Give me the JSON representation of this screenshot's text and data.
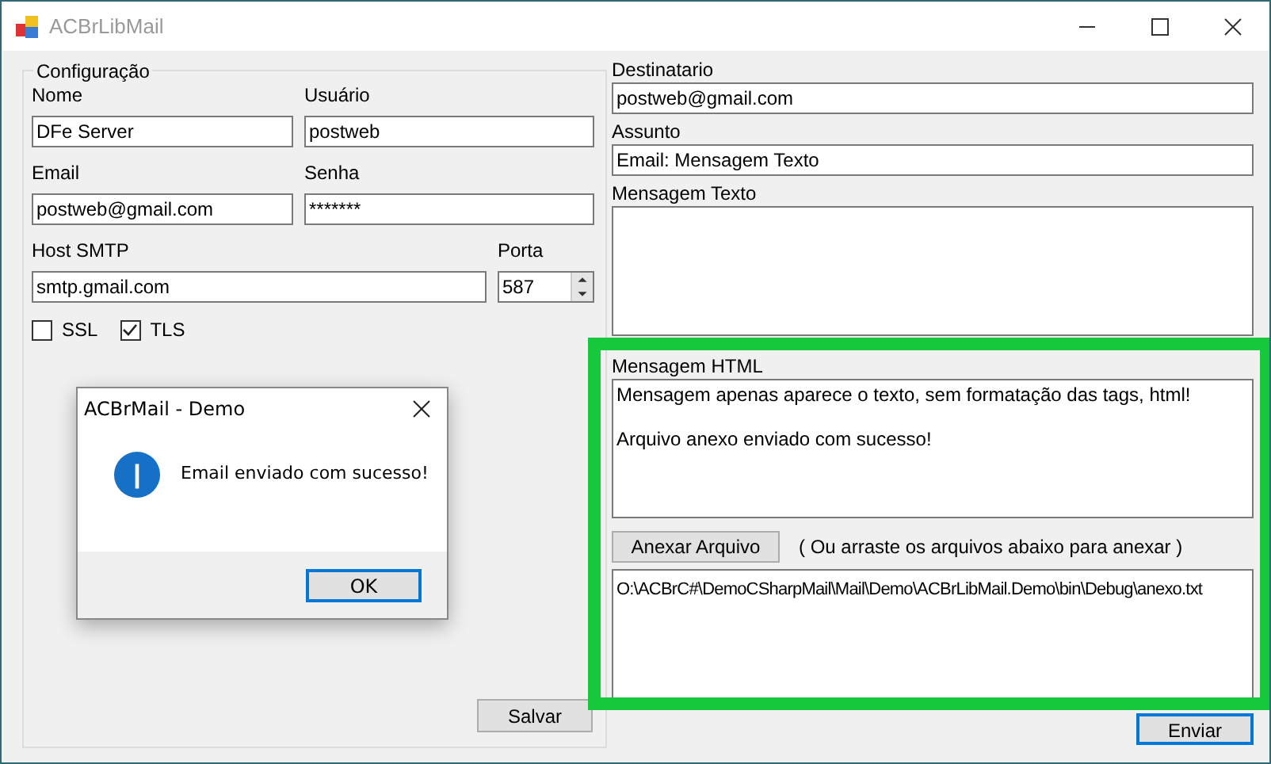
{
  "window": {
    "title": "ACBrLibMail"
  },
  "config": {
    "title": "Configuração",
    "rows": [
      [
        {
          "label": "Nome",
          "value": "DFe Server",
          "kind": "text"
        },
        {
          "label": "Usuário",
          "value": "postweb",
          "kind": "text"
        }
      ],
      [
        {
          "label": "Email",
          "value": "postweb@gmail.com",
          "kind": "text"
        },
        {
          "label": "Senha",
          "value": "*******",
          "kind": "password"
        }
      ],
      [
        {
          "label": "Host SMTP",
          "value": "smtp.gmail.com",
          "kind": "text"
        },
        {
          "label": "Porta",
          "value": "587",
          "kind": "spin"
        }
      ]
    ],
    "checkboxes": [
      {
        "label": "SSL",
        "checked": false
      },
      {
        "label": "TLS",
        "checked": true
      }
    ],
    "save_button": "Salvar"
  },
  "message": {
    "fields": [
      {
        "label": "Destinatario",
        "value": "postweb@gmail.com"
      },
      {
        "label": "Assunto",
        "value": "Email: Mensagem Texto"
      }
    ],
    "text_label": "Mensagem Texto",
    "html_label": "Mensagem HTML",
    "html_lines": [
      "Mensagem apenas aparece o texto, sem formatação das tags, html!",
      "Arquivo anexo enviado com sucesso!"
    ],
    "attach_button": "Anexar Arquivo",
    "attach_hint": "( Ou arraste os arquivos abaixo para anexar )",
    "attachments": [
      "O:\\ACBrC#\\DemoCSharpMail\\Mail\\Demo\\ACBrLibMail.Demo\\bin\\Debug\\anexo.txt"
    ],
    "send_button": "Enviar"
  },
  "dialog": {
    "title": "ACBrMail - Demo",
    "message": "Email enviado com sucesso!",
    "ok_button": "OK"
  }
}
